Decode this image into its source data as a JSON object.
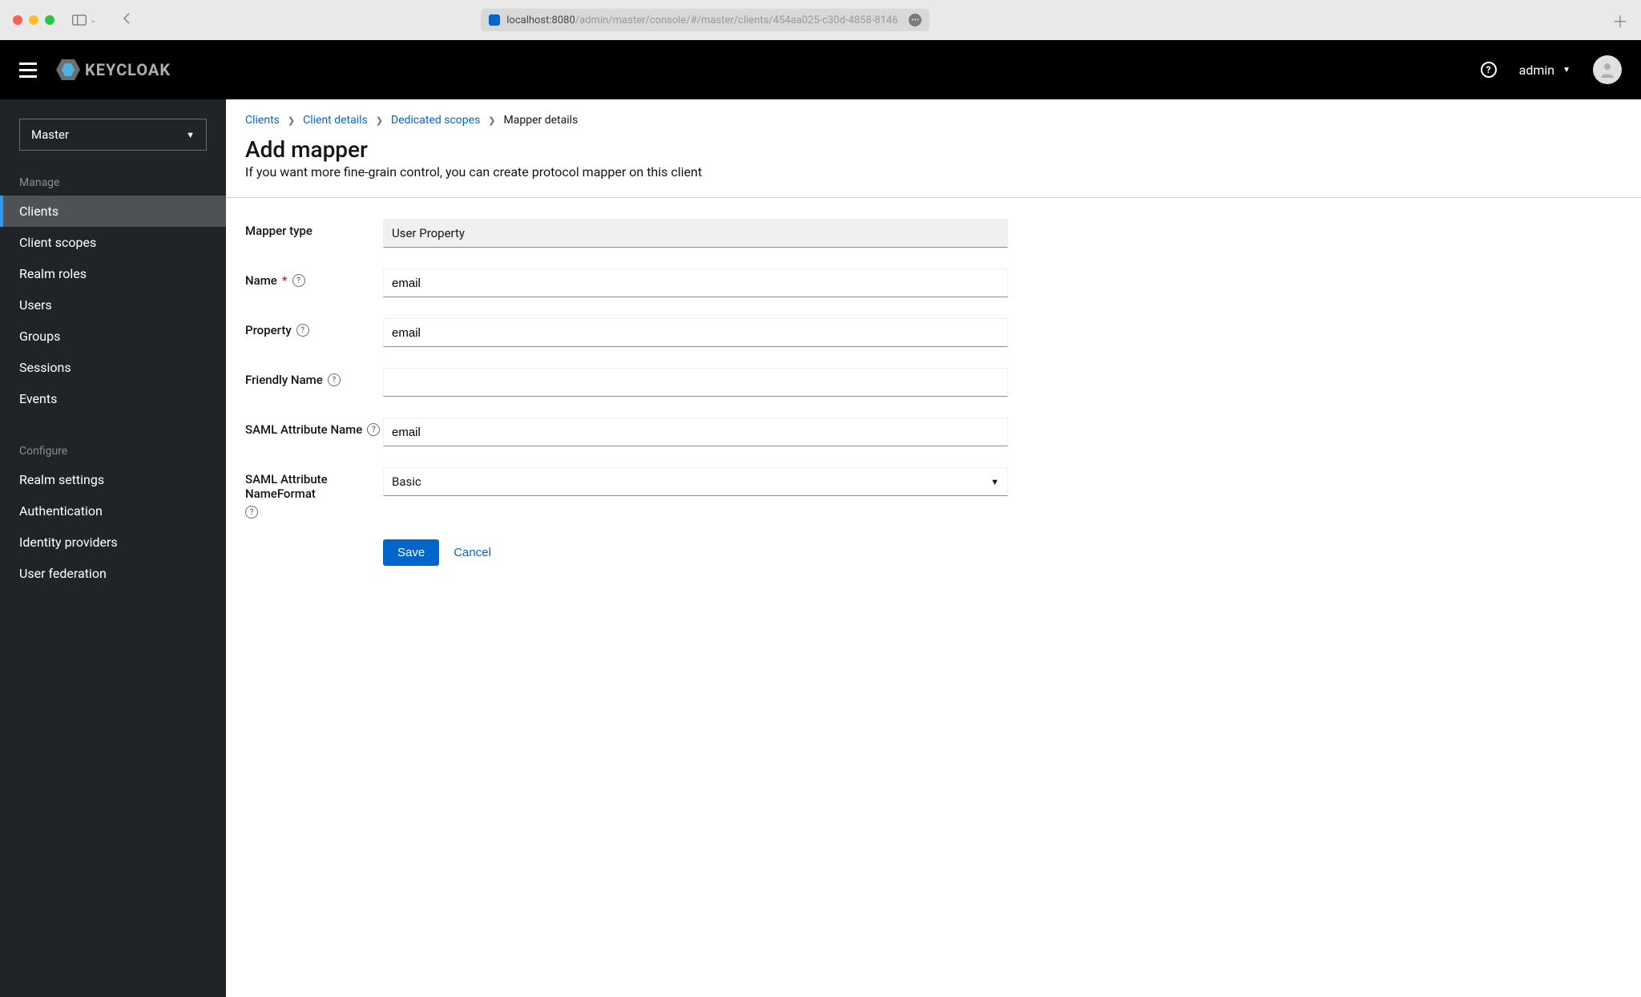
{
  "browser": {
    "url_host": "localhost:8080",
    "url_path": "/admin/master/console/#/master/clients/454aa025-c30d-4858-8146"
  },
  "header": {
    "brand": "KEYCLOAK",
    "user": "admin"
  },
  "sidebar": {
    "realm": "Master",
    "sections": [
      {
        "label": "Manage",
        "items": [
          {
            "label": "Clients",
            "active": true
          },
          {
            "label": "Client scopes"
          },
          {
            "label": "Realm roles"
          },
          {
            "label": "Users"
          },
          {
            "label": "Groups"
          },
          {
            "label": "Sessions"
          },
          {
            "label": "Events"
          }
        ]
      },
      {
        "label": "Configure",
        "items": [
          {
            "label": "Realm settings"
          },
          {
            "label": "Authentication"
          },
          {
            "label": "Identity providers"
          },
          {
            "label": "User federation"
          }
        ]
      }
    ]
  },
  "breadcrumb": {
    "items": [
      {
        "label": "Clients",
        "link": true
      },
      {
        "label": "Client details",
        "link": true
      },
      {
        "label": "Dedicated scopes",
        "link": true
      },
      {
        "label": "Mapper details",
        "link": false
      }
    ]
  },
  "page": {
    "title": "Add mapper",
    "subtitle": "If you want more fine-grain control, you can create protocol mapper on this client"
  },
  "form": {
    "mapper_type": {
      "label": "Mapper type",
      "value": "User Property"
    },
    "name": {
      "label": "Name",
      "value": "email",
      "required": true,
      "help": true
    },
    "property": {
      "label": "Property",
      "value": "email",
      "help": true
    },
    "friendly_name": {
      "label": "Friendly Name",
      "value": "",
      "help": true
    },
    "saml_attr_name": {
      "label": "SAML Attribute Name",
      "value": "email",
      "help": true
    },
    "saml_attr_format": {
      "label": "SAML Attribute NameFormat",
      "value": "Basic",
      "help": true
    },
    "actions": {
      "save": "Save",
      "cancel": "Cancel"
    }
  }
}
